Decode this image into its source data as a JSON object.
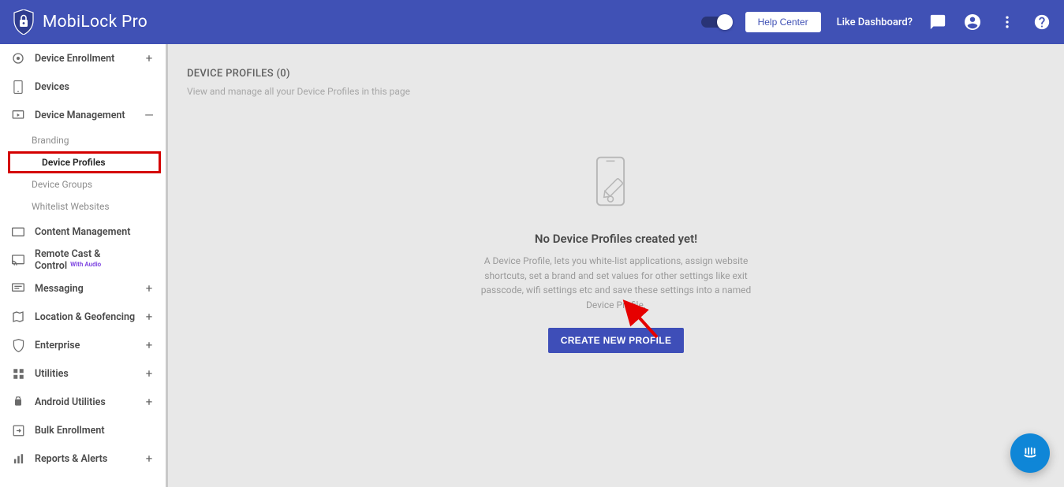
{
  "header": {
    "product_name": "MobiLock Pro",
    "help_center_label": "Help Center",
    "like_dashboard_label": "Like Dashboard?"
  },
  "sidebar": {
    "items": [
      {
        "label": "Device Enrollment",
        "action": "+"
      },
      {
        "label": "Devices",
        "action": ""
      },
      {
        "label": "Device Management",
        "action": "—"
      },
      {
        "label": "Content Management",
        "action": ""
      },
      {
        "label": "Remote Cast & Control",
        "badge": "With Audio",
        "action": ""
      },
      {
        "label": "Messaging",
        "action": "+"
      },
      {
        "label": "Location & Geofencing",
        "action": "+"
      },
      {
        "label": "Enterprise",
        "action": "+"
      },
      {
        "label": "Utilities",
        "action": "+"
      },
      {
        "label": "Android Utilities",
        "action": "+"
      },
      {
        "label": "Bulk Enrollment",
        "action": ""
      },
      {
        "label": "Reports & Alerts",
        "action": "+"
      }
    ],
    "device_management_sub": [
      {
        "label": "Branding"
      },
      {
        "label": "Device Profiles",
        "active": true
      },
      {
        "label": "Device Groups"
      },
      {
        "label": "Whitelist Websites"
      }
    ]
  },
  "main": {
    "title": "DEVICE PROFILES (0)",
    "subtitle": "View and manage all your Device Profiles in this page",
    "empty_title": "No Device Profiles created yet!",
    "empty_desc": "A Device Profile, lets you white-list applications, assign website shortcuts, set a brand and set values for other settings like exit passcode, wifi settings etc and save these settings into a named Device Profile.",
    "create_label": "CREATE NEW PROFILE"
  }
}
